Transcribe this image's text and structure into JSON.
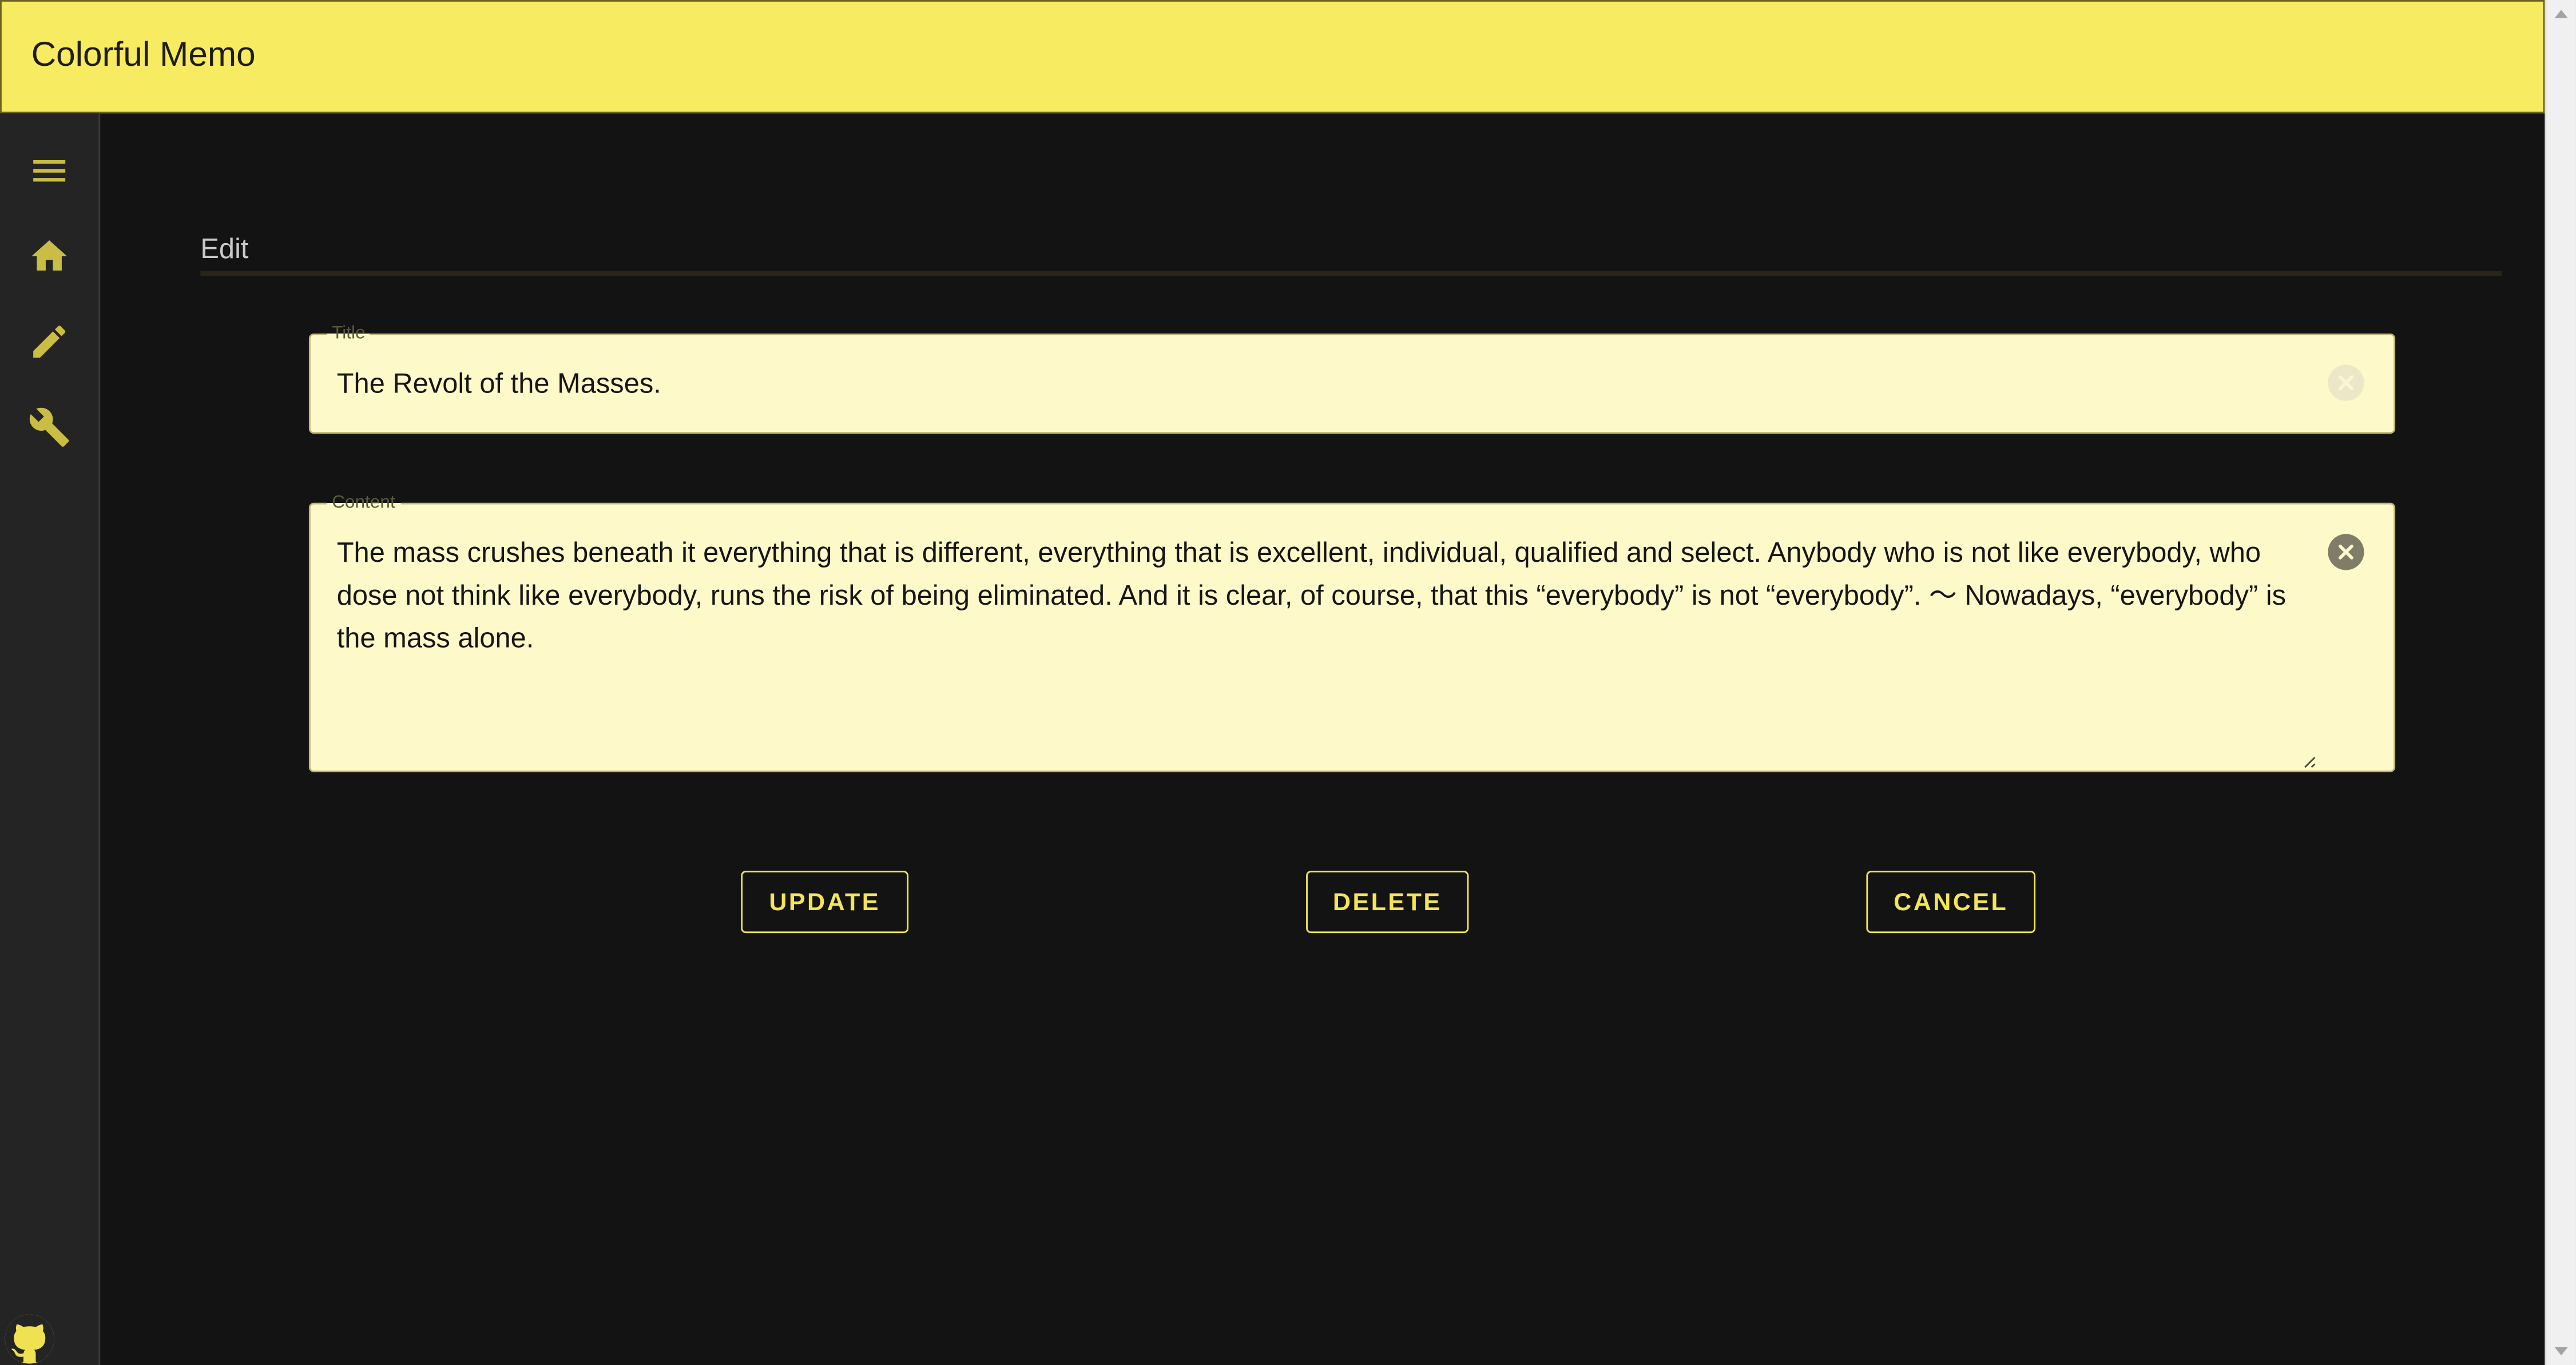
{
  "app": {
    "title": "Colorful Memo"
  },
  "sidebar": {
    "items": [
      {
        "name": "menu",
        "icon": "hamburger-menu-icon"
      },
      {
        "name": "home",
        "icon": "home-icon"
      },
      {
        "name": "edit",
        "icon": "pencil-icon"
      },
      {
        "name": "settings",
        "icon": "wrench-icon"
      }
    ],
    "footer_icon": "github-icon"
  },
  "page": {
    "section_title": "Edit"
  },
  "form": {
    "title_label": "Title",
    "title_value": "The Revolt of the Masses.",
    "content_label": "Content",
    "content_value": "The mass crushes beneath it everything that is different, everything that is excellent, individual, qualified and select. Anybody who is not like everybody, who dose not think like everybody, runs the risk of being eliminated. And it is clear, of course, that this “everybody” is not “everybody”. 〜 Nowadays, “everybody” is the mass alone."
  },
  "actions": {
    "update_label": "UPDATE",
    "delete_label": "DELETE",
    "cancel_label": "CANCEL"
  },
  "colors": {
    "appbar": "#f7eb61",
    "background": "#131313",
    "sidebar": "#242424",
    "accent": "#f3e557",
    "field_background": "#fef9c9"
  }
}
